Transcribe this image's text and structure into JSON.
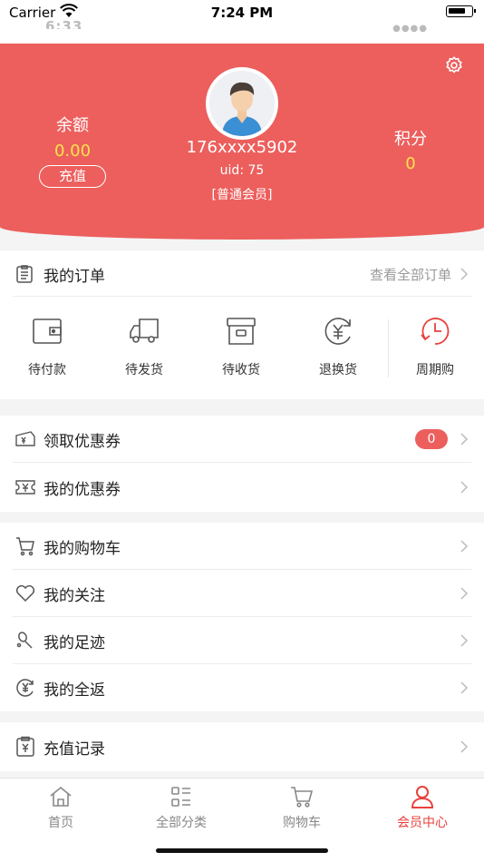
{
  "status_bar": {
    "carrier": "Carrier",
    "time": "7:24 PM"
  },
  "header": {
    "balance_label": "余额",
    "balance_value": "0.00",
    "recharge_button": "充值",
    "phone": "176xxxx5902",
    "uid": "uid: 75",
    "member_level": "[普通会员]",
    "points_label": "积分",
    "points_value": "0"
  },
  "orders": {
    "title": "我的订单",
    "view_all": "查看全部订单",
    "items": [
      {
        "label": "待付款",
        "icon": "wallet-icon"
      },
      {
        "label": "待发货",
        "icon": "truck-icon"
      },
      {
        "label": "待收货",
        "icon": "box-icon"
      },
      {
        "label": "退换货",
        "icon": "yen-return-icon"
      },
      {
        "label": "周期购",
        "icon": "cycle-clock-icon"
      }
    ]
  },
  "coupons": {
    "get_coupon": "领取优惠券",
    "get_coupon_count": "0",
    "my_coupon": "我的优惠券"
  },
  "menu": {
    "cart": "我的购物车",
    "follow": "我的关注",
    "footprint": "我的足迹",
    "cashback": "我的全返"
  },
  "recharge_record": "充值记录",
  "tabbar": {
    "items": [
      {
        "label": "首页",
        "icon": "home-icon"
      },
      {
        "label": "全部分类",
        "icon": "category-icon"
      },
      {
        "label": "购物车",
        "icon": "cart-icon"
      },
      {
        "label": "会员中心",
        "icon": "user-icon",
        "active": true
      }
    ]
  },
  "colors": {
    "brand_red": "#ec5f5d",
    "highlight_yellow": "#ffe14d",
    "active_tab": "#e8413d"
  }
}
